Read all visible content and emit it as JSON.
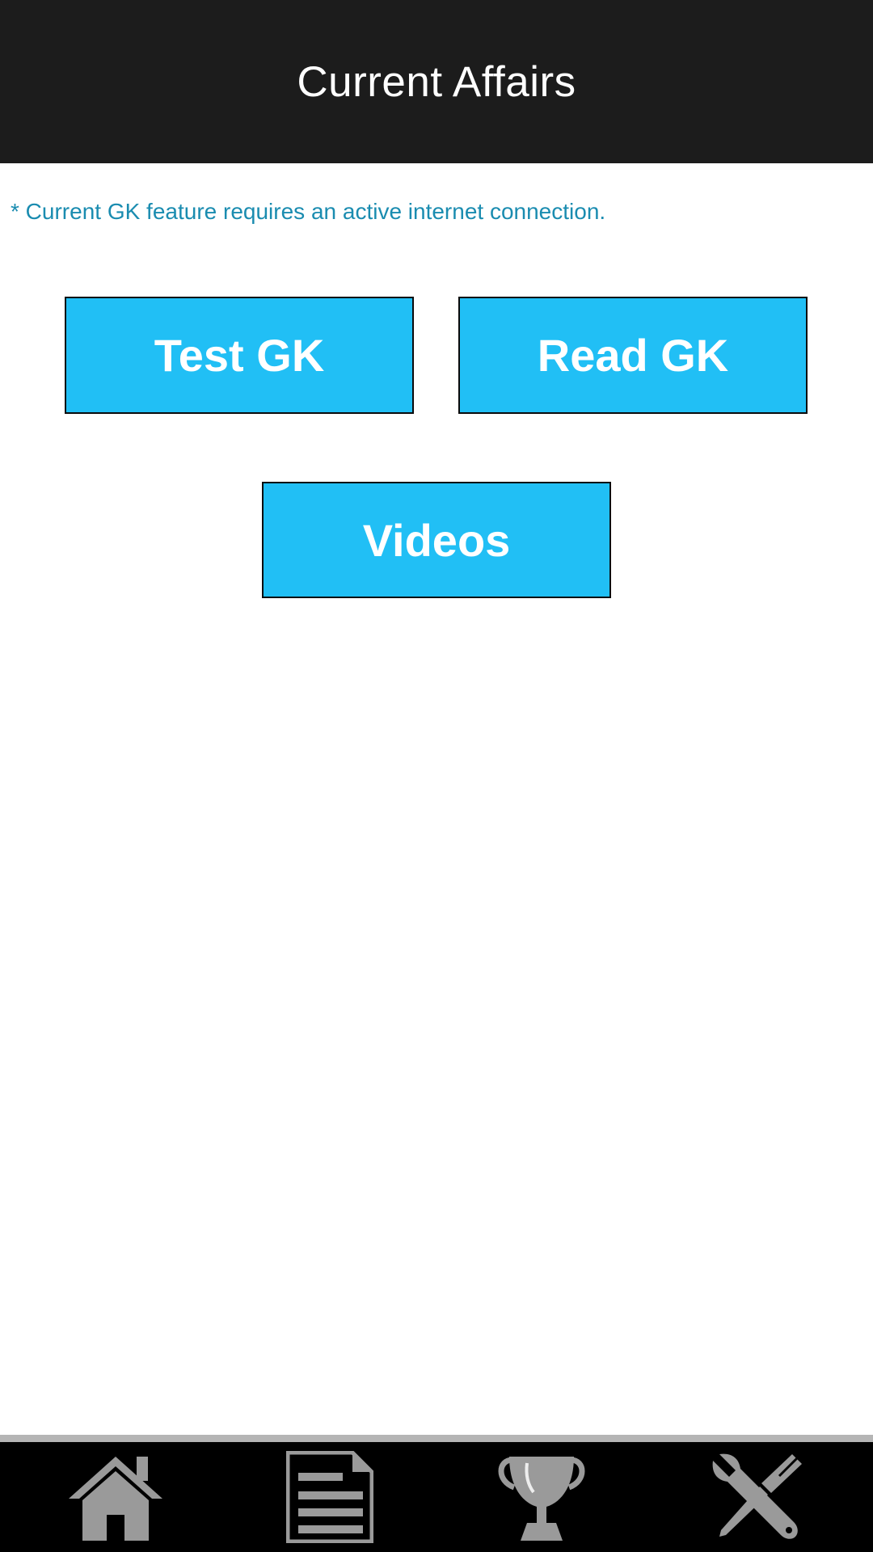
{
  "header": {
    "title": "Current Affairs"
  },
  "notice": {
    "text": "* Current GK feature requires an active internet connection."
  },
  "buttons": {
    "test_gk": "Test GK",
    "read_gk": "Read GK",
    "videos": "Videos"
  },
  "bottom_nav": {
    "items": [
      {
        "icon": "home-icon"
      },
      {
        "icon": "document-icon"
      },
      {
        "icon": "trophy-icon"
      },
      {
        "icon": "tools-icon"
      }
    ]
  },
  "colors": {
    "header_bg": "#1c1c1c",
    "button_bg": "#21bff5",
    "notice_text": "#1a8cb0",
    "nav_bg": "#000000",
    "nav_icon": "#9a9a9a"
  }
}
